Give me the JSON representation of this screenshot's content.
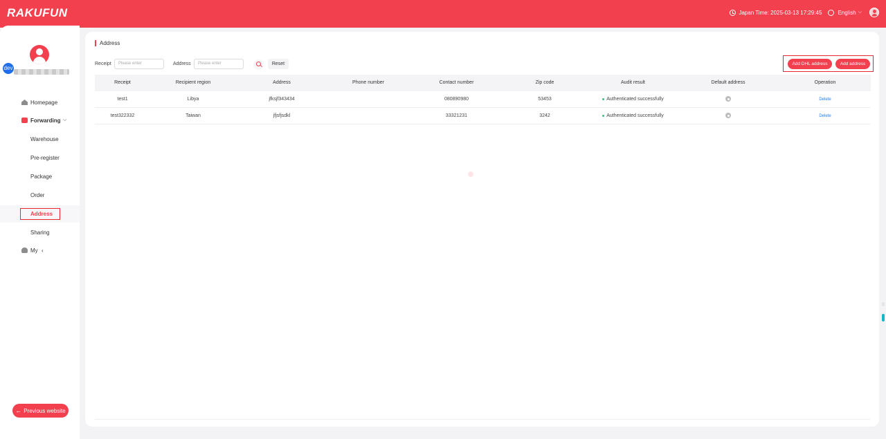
{
  "header": {
    "logo": "RAKUFUN",
    "time_text": "Japan Time: 2025-03-13 17:29:45",
    "language": "English"
  },
  "profile": {
    "badge": "dev"
  },
  "sidebar": {
    "homepage": "Homepage",
    "forwarding": "Forwarding",
    "sub_items": [
      "Warehouse",
      "Pre-register",
      "Package",
      "Order",
      "Address",
      "Sharing"
    ],
    "my": "My",
    "previous_website": "Previous website"
  },
  "page": {
    "title": "Address"
  },
  "filters": {
    "receipt_label": "Receipt",
    "receipt_placeholder": "Please enter",
    "address_label": "Address",
    "address_placeholder": "Please enter",
    "reset": "Reset"
  },
  "actions": {
    "add_dhl": "Add DHL address",
    "add_address": "Add address"
  },
  "table": {
    "headers": [
      "Receipt",
      "Recipient region",
      "Address",
      "Phone number",
      "Contact number",
      "Zip code",
      "Audit result",
      "Default address",
      "Operation"
    ],
    "rows": [
      {
        "receipt": "test1",
        "region": "Libya",
        "address": "jfksjf343434",
        "phone": "",
        "contact": "080890980",
        "zip": "53453",
        "audit": "Authenticated successfully",
        "operation": "Delete"
      },
      {
        "receipt": "test322332",
        "region": "Taiwan",
        "address": "jfjsfjsdkl",
        "phone": "",
        "contact": "33321231",
        "zip": "3242",
        "audit": "Authenticated successfully",
        "operation": "Delete"
      }
    ]
  },
  "colors": {
    "brand": "#f2404f",
    "link": "#1e7ef2",
    "success": "#3cc27a",
    "highlight_box": "#e8262e"
  }
}
